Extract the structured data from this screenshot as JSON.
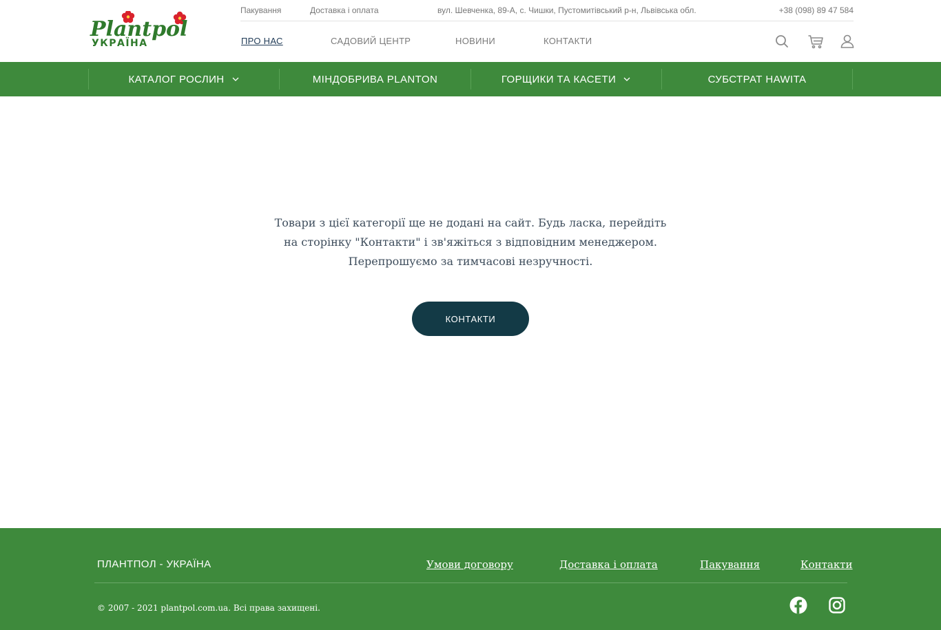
{
  "header": {
    "logo": {
      "brand_text": "Plantpol",
      "country_text": "УКРАЇНА",
      "icon": "flower-logo-icon"
    },
    "topbar": {
      "packaging_link": "Пакування",
      "delivery_link": "Доставка і оплата",
      "address": "вул. Шевченка, 89-А, с. Чишки, Пустомитівський р-н, Львівська обл.",
      "phone": "+38 (098) 89 47 584"
    },
    "nav": {
      "about": "ПРО НАС",
      "garden_center": "САДОВИЙ ЦЕНТР",
      "news": "НОВИНИ",
      "contacts": "КОНТАКТИ"
    },
    "icons": [
      "search-icon",
      "cart-icon",
      "user-icon"
    ]
  },
  "catalog_bar": {
    "items": [
      {
        "label": "КАТАЛОГ РОСЛИН",
        "has_dropdown": true
      },
      {
        "label": "МІНДОБРИВА PLANTON",
        "has_dropdown": false
      },
      {
        "label": "ГОРЩИКИ ТА КАСЕТИ",
        "has_dropdown": true
      },
      {
        "label": "СУБСТРАТ HAWITA",
        "has_dropdown": false
      }
    ]
  },
  "main": {
    "message_lines": [
      "Товари з цієї категорії ще не додані на сайт. Будь ласка, перейдіть",
      "на сторінку \"Контакти\" і зв'яжіться з відповідним менеджером.",
      "Перепрошуємо за тимчасові незручності."
    ],
    "button_label": "КОНТАКТИ"
  },
  "footer": {
    "brand": "ПЛАНТПОЛ - УКРАЇНА",
    "links": {
      "terms": "Умови договору",
      "delivery": "Доставка і оплата",
      "packaging": "Пакування",
      "contacts": "Контакти"
    },
    "copyright": "© 2007 - 2021 plantpol.com.ua. Всі права захищені.",
    "social": [
      "facebook-icon",
      "instagram-icon"
    ]
  },
  "colors": {
    "green": "#3e8a3c",
    "button_dark": "#133a46",
    "logo_red": "#d9232d",
    "logo_green": "#2f7a2c"
  }
}
